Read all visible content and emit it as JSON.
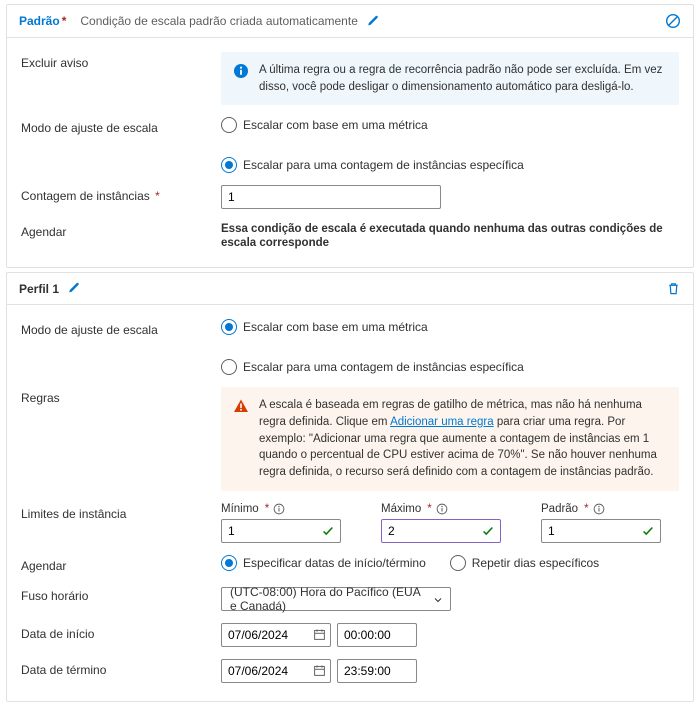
{
  "padrao": {
    "title": "Padrão",
    "subtitle": "Condição de escala padrão criada automaticamente",
    "excluirAviso": "Excluir aviso",
    "infoMsg": "A última regra ou a regra de recorrência padrão não pode ser excluída. Em vez disso, você pode desligar o dimensionamento automático para desligá-lo.",
    "modoLabel": "Modo de ajuste de escala",
    "radioMetric": "Escalar com base em uma métrica",
    "radioCount": "Escalar para uma contagem de instâncias específica",
    "contagemLabel": "Contagem de instâncias",
    "contagemValue": "1",
    "agendarLabel": "Agendar",
    "agendarText": "Essa condição de escala é executada quando nenhuma das outras condições de escala corresponde"
  },
  "perfil": {
    "title": "Perfil 1",
    "modoLabel": "Modo de ajuste de escala",
    "radioMetric": "Escalar com base em uma métrica",
    "radioCount": "Escalar para uma contagem de instâncias específica",
    "regrasLabel": "Regras",
    "warnPre": "A escala é baseada em regras de gatilho de métrica, mas não há nenhuma regra definida. Clique em ",
    "warnLink": "Adicionar uma regra",
    "warnPost": " para criar uma regra. Por exemplo: \"Adicionar uma regra que aumente a contagem de instâncias em 1 quando o percentual de CPU estiver acima de 70%\". Se não houver nenhuma regra definida, o recurso será definido com a contagem de instâncias padrão.",
    "limitesLabel": "Limites de instância",
    "minLabel": "Mínimo",
    "maxLabel": "Máximo",
    "padLabel": "Padrão",
    "minVal": "1",
    "maxVal": "2",
    "padVal": "1",
    "agendarLabel": "Agendar",
    "schedDates": "Especificar datas de início/término",
    "schedRepeat": "Repetir dias específicos",
    "fusoLabel": "Fuso horário",
    "fusoVal": "(UTC-08:00) Hora do Pacífico (EUA e Canadá)",
    "inicioLabel": "Data de início",
    "terminoLabel": "Data de término",
    "dateStart": "07/06/2024",
    "timeStart": "00:00:00",
    "dateEnd": "07/06/2024",
    "timeEnd": "23:59:00"
  }
}
